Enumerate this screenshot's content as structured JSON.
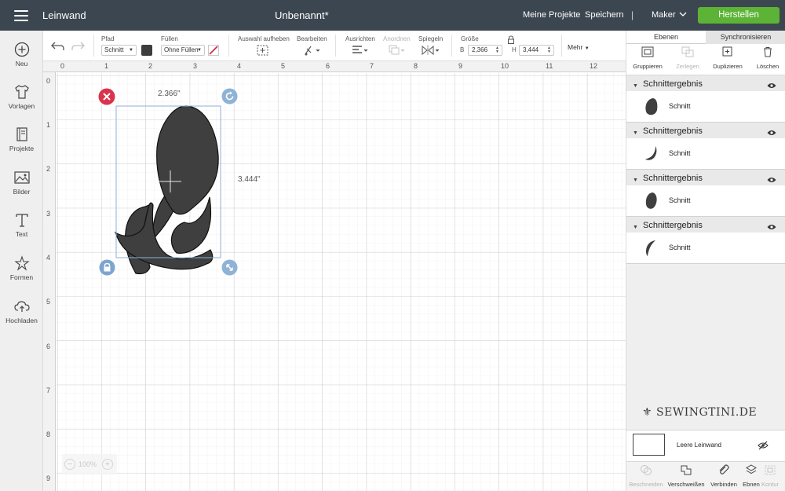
{
  "topbar": {
    "app_title": "Leinwand",
    "doc_title": "Unbenannt*",
    "my_projects": "Meine Projekte",
    "save": "Speichern",
    "separator": "|",
    "maker": "Maker",
    "make_button": "Herstellen",
    "make_color": "#5cb335"
  },
  "sidebar": {
    "new": "Neu",
    "templates": "Vorlagen",
    "projects": "Projekte",
    "images": "Bilder",
    "text": "Text",
    "shapes": "Formen",
    "upload": "Hochladen"
  },
  "toolbar": {
    "path_label": "Pfad",
    "path_value": "Schnitt",
    "fill_label": "Füllen",
    "fill_value": "Ohne Füllen",
    "deselect_label": "Auswahl aufheben",
    "edit_label": "Bearbeiten",
    "align_label": "Ausrichten",
    "arrange_label": "Anordnen",
    "flip_label": "Spiegeln",
    "size_label": "Größe",
    "width_letter": "B",
    "width_value": "2,366",
    "height_letter": "H",
    "height_value": "3,444",
    "more_label": "Mehr",
    "color": "#3d3d3d"
  },
  "canvas": {
    "ruler_top": [
      "0",
      "1",
      "2",
      "3",
      "4",
      "5",
      "6",
      "7",
      "8",
      "9",
      "10",
      "11",
      "12"
    ],
    "ruler_left": [
      "0",
      "1",
      "2",
      "3",
      "4",
      "5",
      "6",
      "7",
      "8",
      "9"
    ],
    "width_dim": "2.366\"",
    "height_dim": "3.444\"",
    "zoom": "100%",
    "zoom_minus": "−",
    "zoom_plus": "+"
  },
  "panel": {
    "tab_layers": "Ebenen",
    "tab_sync": "Synchronisieren",
    "group_label": "Gruppieren",
    "ungroup_label": "Zerlegen",
    "duplicate_label": "Duplizieren",
    "delete_label": "Löschen",
    "groups": [
      {
        "title": "Schnittergebnis",
        "layer": "Schnitt"
      },
      {
        "title": "Schnittergebnis",
        "layer": "Schnitt"
      },
      {
        "title": "Schnittergebnis",
        "layer": "Schnitt"
      },
      {
        "title": "Schnittergebnis",
        "layer": "Schnitt"
      }
    ],
    "watermark": "SEWINGTINI.DE",
    "blank_canvas": "Leere Leinwand",
    "bottom": {
      "slice": "Beschneiden",
      "weld": "Verschweißen",
      "attach": "Verbinden",
      "flatten": "Ebnen",
      "contour": "Kontur"
    }
  }
}
